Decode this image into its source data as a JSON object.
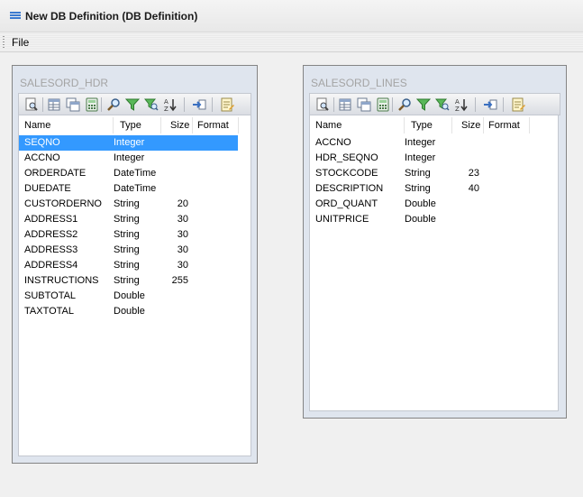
{
  "window": {
    "title": "New DB Definition (DB Definition)"
  },
  "menu": {
    "file": "File"
  },
  "columns": {
    "name": "Name",
    "type": "Type",
    "size": "Size",
    "format": "Format"
  },
  "tables": [
    {
      "name": "SALESORD_HDR",
      "selected_index": 0,
      "rows": [
        {
          "name": "SEQNO",
          "type": "Integer",
          "size": ""
        },
        {
          "name": "ACCNO",
          "type": "Integer",
          "size": ""
        },
        {
          "name": "ORDERDATE",
          "type": "DateTime",
          "size": ""
        },
        {
          "name": "DUEDATE",
          "type": "DateTime",
          "size": ""
        },
        {
          "name": "CUSTORDERNO",
          "type": "String",
          "size": "20"
        },
        {
          "name": "ADDRESS1",
          "type": "String",
          "size": "30"
        },
        {
          "name": "ADDRESS2",
          "type": "String",
          "size": "30"
        },
        {
          "name": "ADDRESS3",
          "type": "String",
          "size": "30"
        },
        {
          "name": "ADDRESS4",
          "type": "String",
          "size": "30"
        },
        {
          "name": "INSTRUCTIONS",
          "type": "String",
          "size": "255"
        },
        {
          "name": "SUBTOTAL",
          "type": "Double",
          "size": ""
        },
        {
          "name": "TAXTOTAL",
          "type": "Double",
          "size": ""
        }
      ]
    },
    {
      "name": "SALESORD_LINES",
      "selected_index": -1,
      "rows": [
        {
          "name": "ACCNO",
          "type": "Integer",
          "size": ""
        },
        {
          "name": "HDR_SEQNO",
          "type": "Integer",
          "size": ""
        },
        {
          "name": "STOCKCODE",
          "type": "String",
          "size": "23"
        },
        {
          "name": "DESCRIPTION",
          "type": "String",
          "size": "40"
        },
        {
          "name": "ORD_QUANT",
          "type": "Double",
          "size": ""
        },
        {
          "name": "UNITPRICE",
          "type": "Double",
          "size": ""
        }
      ]
    }
  ],
  "toolbar_icons": [
    "preview-icon",
    "grid-icon",
    "copy-grid-icon",
    "calculator-icon",
    "search-icon",
    "filter-icon",
    "find-filter-icon",
    "sort-az-icon",
    "import-icon",
    "notes-icon"
  ],
  "colors": {
    "selection": "#3399ff",
    "title_icon": "#3b7bd0",
    "panel_bg": "#dfe5ee"
  }
}
